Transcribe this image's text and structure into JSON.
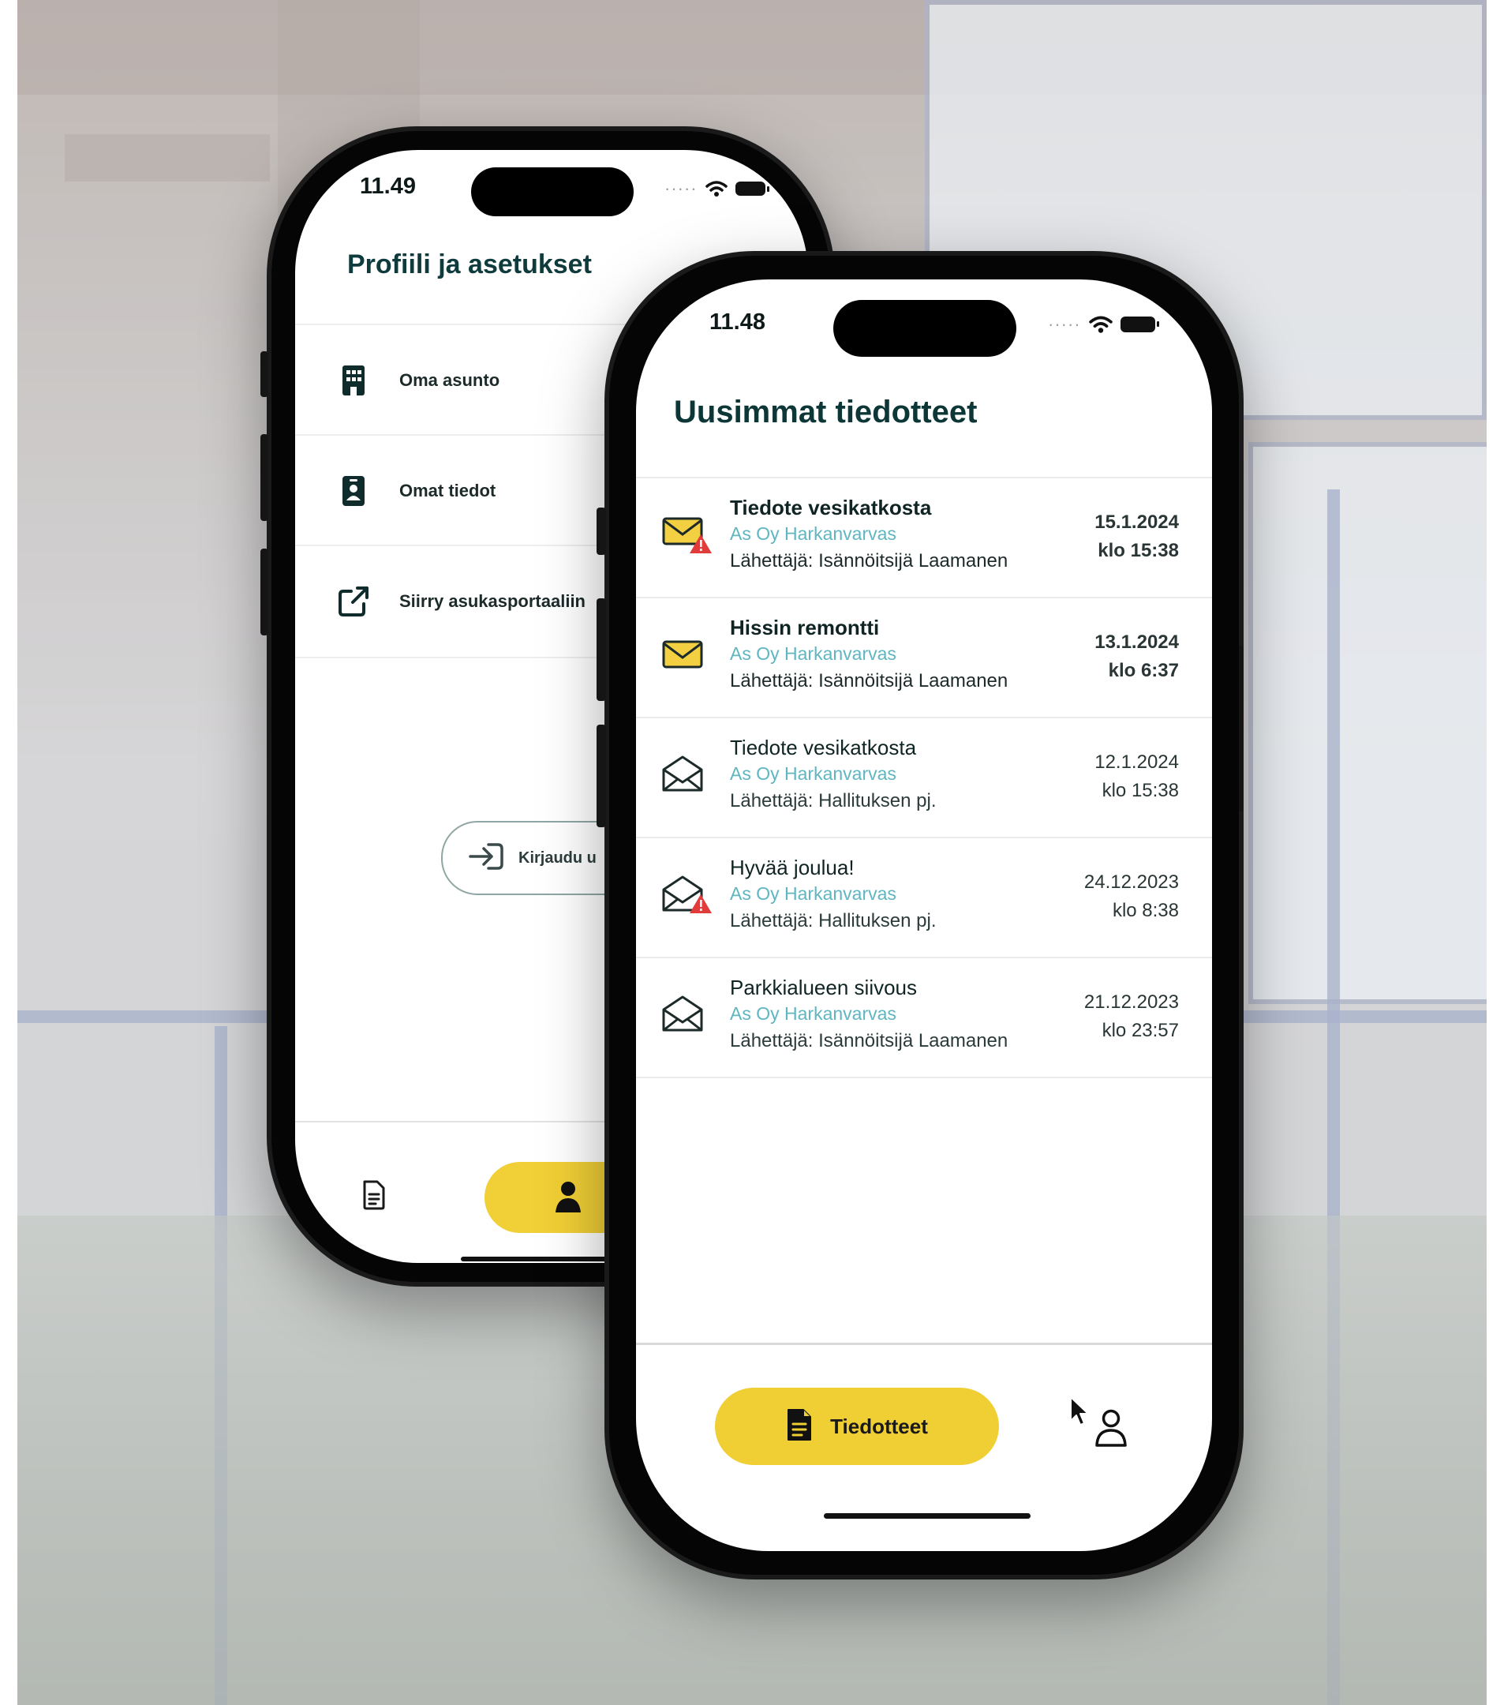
{
  "back_screen": {
    "status_time": "11.49",
    "title": "Profiili ja asetukset",
    "menu": [
      {
        "label": "Oma asunto",
        "icon": "building-icon"
      },
      {
        "label": "Omat tiedot",
        "icon": "id-badge-icon"
      },
      {
        "label": "Siirry asukasportaaliin",
        "icon": "external-link-icon"
      }
    ],
    "login_button": "Kirjaudu u",
    "tabs": {
      "documents_icon": "document-icon",
      "profile_icon": "person-icon"
    }
  },
  "front_screen": {
    "status_time": "11.48",
    "title": "Uusimmat tiedotteet",
    "notices": [
      {
        "title": "Tiedote vesikatkosta",
        "org": "As Oy Harkanvarvas",
        "sender": "Lähettäjä: Isännöitsijä Laamanen",
        "date": "15.1.2024",
        "time": "klo 15:38",
        "unread": true,
        "warning": true,
        "icon": "closed-envelope-warning-icon"
      },
      {
        "title": "Hissin remontti",
        "org": "As Oy Harkanvarvas",
        "sender": "Lähettäjä: Isännöitsijä Laamanen",
        "date": "13.1.2024",
        "time": "klo 6:37",
        "unread": true,
        "warning": false,
        "icon": "closed-envelope-icon"
      },
      {
        "title": "Tiedote vesikatkosta",
        "org": "As Oy Harkanvarvas",
        "sender": "Lähettäjä: Hallituksen pj.",
        "date": "12.1.2024",
        "time": "klo 15:38",
        "unread": false,
        "warning": false,
        "icon": "open-envelope-icon"
      },
      {
        "title": "Hyvää joulua!",
        "org": "As Oy Harkanvarvas",
        "sender": "Lähettäjä: Hallituksen pj.",
        "date": "24.12.2023",
        "time": "klo 8:38",
        "unread": false,
        "warning": true,
        "icon": "open-envelope-warning-icon"
      },
      {
        "title": "Parkkialueen siivous",
        "org": "As Oy Harkanvarvas",
        "sender": "Lähettäjä: Isännöitsijä Laamanen",
        "date": "21.12.2023",
        "time": "klo 23:57",
        "unread": false,
        "warning": false,
        "icon": "open-envelope-icon"
      }
    ],
    "tabs": {
      "active_label": "Tiedotteet",
      "profile_icon": "person-outline-icon"
    }
  },
  "colors": {
    "accent": "#f0cf34",
    "title": "#0d3637",
    "org": "#5fb6c0",
    "warning": "#e23b3b"
  }
}
